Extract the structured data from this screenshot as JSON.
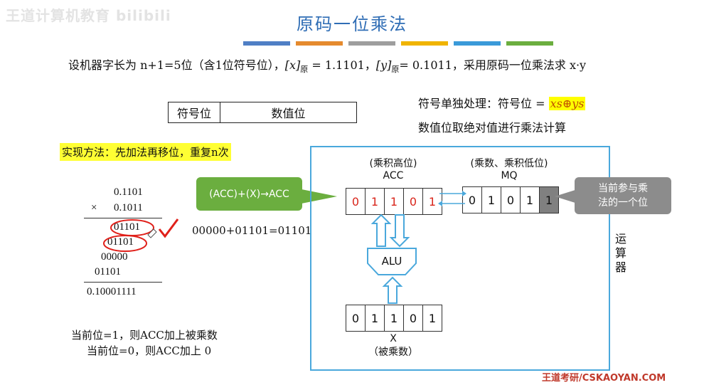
{
  "watermark": "王道计算机教育 bilibili",
  "title": "原码一位乘法",
  "title_bar_colors": [
    "#4f7fc5",
    "#e58a2e",
    "#9e9e9e",
    "#f0b400",
    "#3a9ad9",
    "#6bae3f"
  ],
  "problem": {
    "prefix": "设机器字长为 n+1=5位（含1位符号位），",
    "x_label": "[x]",
    "x_sub": "原",
    "x_value": " = 1.1101，",
    "y_label": "[y]",
    "y_sub": "原",
    "y_value": "= 0.1011，",
    "suffix": "采用原码一位乘法求 x·y"
  },
  "format_table": {
    "sign": "符号位",
    "value": "数值位"
  },
  "notes": {
    "sign_prefix": "符号单独处理：符号位 = ",
    "sign_formula": "xs⊕ys",
    "value_line": "数值位取绝对值进行乘法计算"
  },
  "method": "实现方法：先加法再移位，重复n次",
  "calculation": {
    "multiplicand": "0.1101",
    "times": "×",
    "multiplier": "0.1011",
    "partials": [
      "01101",
      "01101",
      "00000",
      "01101"
    ],
    "result": "0.10001111"
  },
  "bottom_notes": [
    "当前位=1，则ACC加上被乘数",
    "当前位=0，则ACC加上 0"
  ],
  "acc_callout": "(ACC)+(X)→ACC",
  "acc_equation": "00000+01101=01101",
  "acc": {
    "caption1": "(乘积高位)",
    "caption2": "ACC",
    "bits": [
      "0",
      "1",
      "1",
      "0",
      "1"
    ]
  },
  "mq": {
    "caption1": "(乘数、乘积低位)",
    "caption2": "MQ",
    "bits": [
      "0",
      "1",
      "0",
      "1",
      "1"
    ]
  },
  "alu_label": "ALU",
  "x_reg": {
    "bits": [
      "0",
      "1",
      "1",
      "0",
      "1"
    ],
    "caption1": "X",
    "caption2": "（被乘数）"
  },
  "mq_callout": [
    "当前参与乘",
    "法的一个位"
  ],
  "unit_label": [
    "运",
    "算",
    "器"
  ],
  "footer": "王道考研/CSKAOYAN.COM"
}
